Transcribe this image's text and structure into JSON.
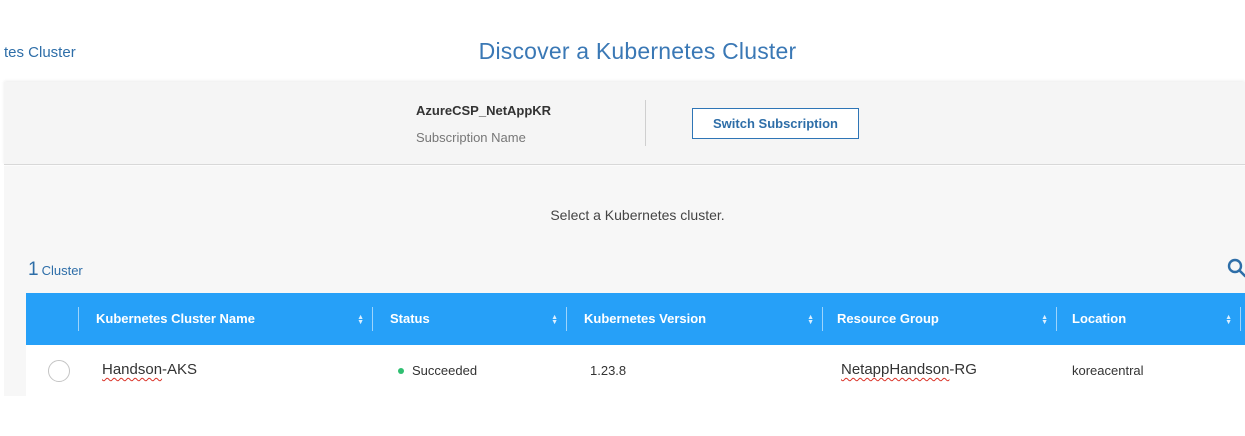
{
  "header": {
    "breadcrumb": "tes Cluster",
    "title": "Discover a Kubernetes Cluster"
  },
  "subscription": {
    "name": "AzureCSP_NetAppKR",
    "label": "Subscription Name",
    "switch_label": "Switch Subscription"
  },
  "main": {
    "prompt": "Select a Kubernetes cluster.",
    "count": "1",
    "count_unit": "Cluster",
    "search_icon": "search-icon"
  },
  "table": {
    "columns": [
      {
        "label": "Kubernetes Cluster Name",
        "sort_icon": "sort-icon"
      },
      {
        "label": "Status",
        "sort_icon": "sort-icon"
      },
      {
        "label": "Kubernetes Version",
        "sort_icon": "sort-icon"
      },
      {
        "label": "Resource Group",
        "sort_icon": "sort-icon"
      },
      {
        "label": "Location",
        "sort_icon": "sort-icon"
      }
    ],
    "rows": [
      {
        "name_part1": "Handson",
        "name_part2": "-AKS",
        "status": "Succeeded",
        "version": "1.23.8",
        "group_part1": "NetappHandson",
        "group_part2": "-RG",
        "location": "koreacentral"
      }
    ]
  },
  "colors": {
    "accent": "#2e6ea8",
    "table_header": "#26a0f8",
    "status_ok": "#2fbf71"
  }
}
